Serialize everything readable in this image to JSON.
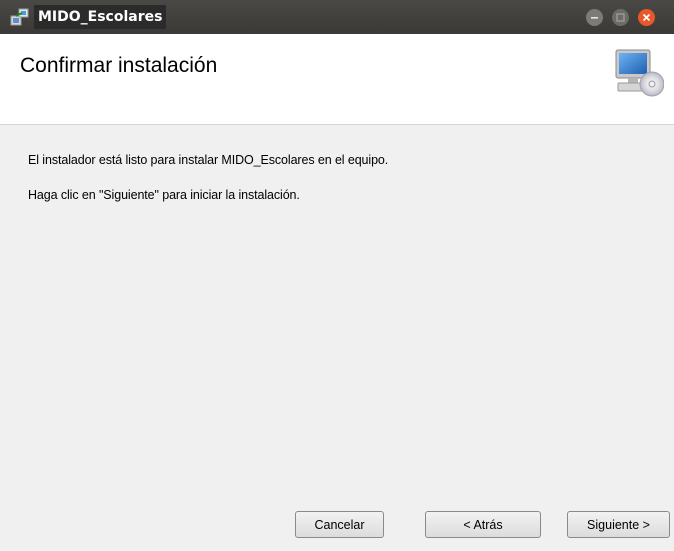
{
  "window": {
    "title": "MIDO_Escolares",
    "icons": {
      "app": "installer-app-icon",
      "minimize": "minimize-icon",
      "maximize": "maximize-icon",
      "close": "close-icon"
    },
    "colors": {
      "titlebar": "#3f3e3a",
      "close": "#e8582a"
    }
  },
  "header": {
    "title": "Confirmar instalación",
    "icon": "computer-cd-icon"
  },
  "body": {
    "line1": "El instalador está listo para instalar MIDO_Escolares en el equipo.",
    "line2": "Haga clic en \"Siguiente\" para iniciar la instalación."
  },
  "buttons": {
    "cancel": "Cancelar",
    "back": "< Atrás",
    "next": "Siguiente >"
  }
}
